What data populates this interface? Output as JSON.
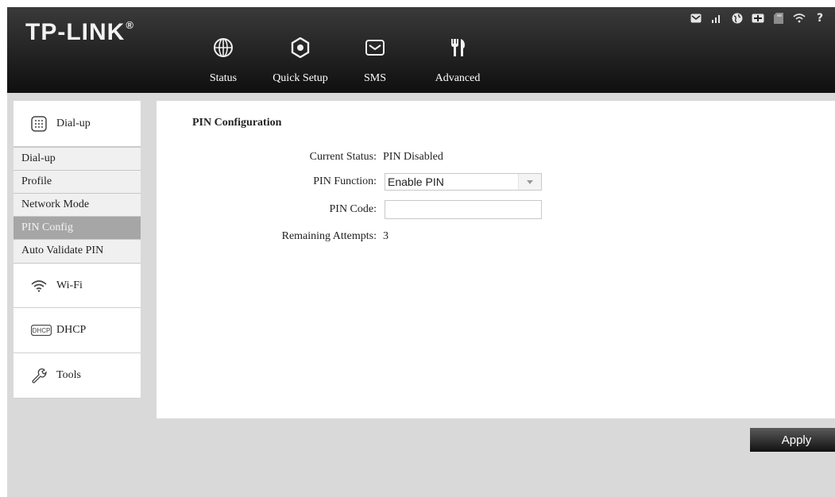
{
  "header": {
    "logo": "TP-LINK",
    "logo_mark": "®",
    "nav": [
      {
        "label": "Status",
        "icon": "globe-icon"
      },
      {
        "label": "Quick Setup",
        "icon": "gear-icon"
      },
      {
        "label": "SMS",
        "icon": "envelope-icon"
      },
      {
        "label": "Advanced",
        "icon": "tools-icon"
      }
    ],
    "status_icons": [
      "message-icon",
      "signal-icon",
      "globe-icon",
      "battery-icon",
      "sd-card-icon",
      "wifi-icon",
      "help-icon"
    ]
  },
  "sidebar": {
    "groups": [
      {
        "label": "Dial-up",
        "icon": "dialpad-icon"
      },
      {
        "label": "Wi-Fi",
        "icon": "wifi-icon"
      },
      {
        "label": "DHCP",
        "icon": "dhcp-icon",
        "icon_text": "DHCP"
      },
      {
        "label": "Tools",
        "icon": "wrench-icon"
      }
    ],
    "dialup_items": [
      {
        "label": "Dial-up",
        "active": false
      },
      {
        "label": "Profile",
        "active": false
      },
      {
        "label": "Network Mode",
        "active": false
      },
      {
        "label": "PIN Config",
        "active": true
      },
      {
        "label": "Auto Validate PIN",
        "active": false
      }
    ]
  },
  "main": {
    "title": "PIN Configuration",
    "current_status_label": "Current Status:",
    "current_status_value": "PIN Disabled",
    "pin_function_label": "PIN Function:",
    "pin_function_value": "Enable PIN",
    "pin_code_label": "PIN Code:",
    "pin_code_value": "",
    "remaining_label": "Remaining Attempts:",
    "remaining_value": "3"
  },
  "apply_label": "Apply",
  "colors": {
    "header": "#1a1a1a",
    "active_item": "#a6a6a6",
    "background": "#d9d9d9"
  }
}
